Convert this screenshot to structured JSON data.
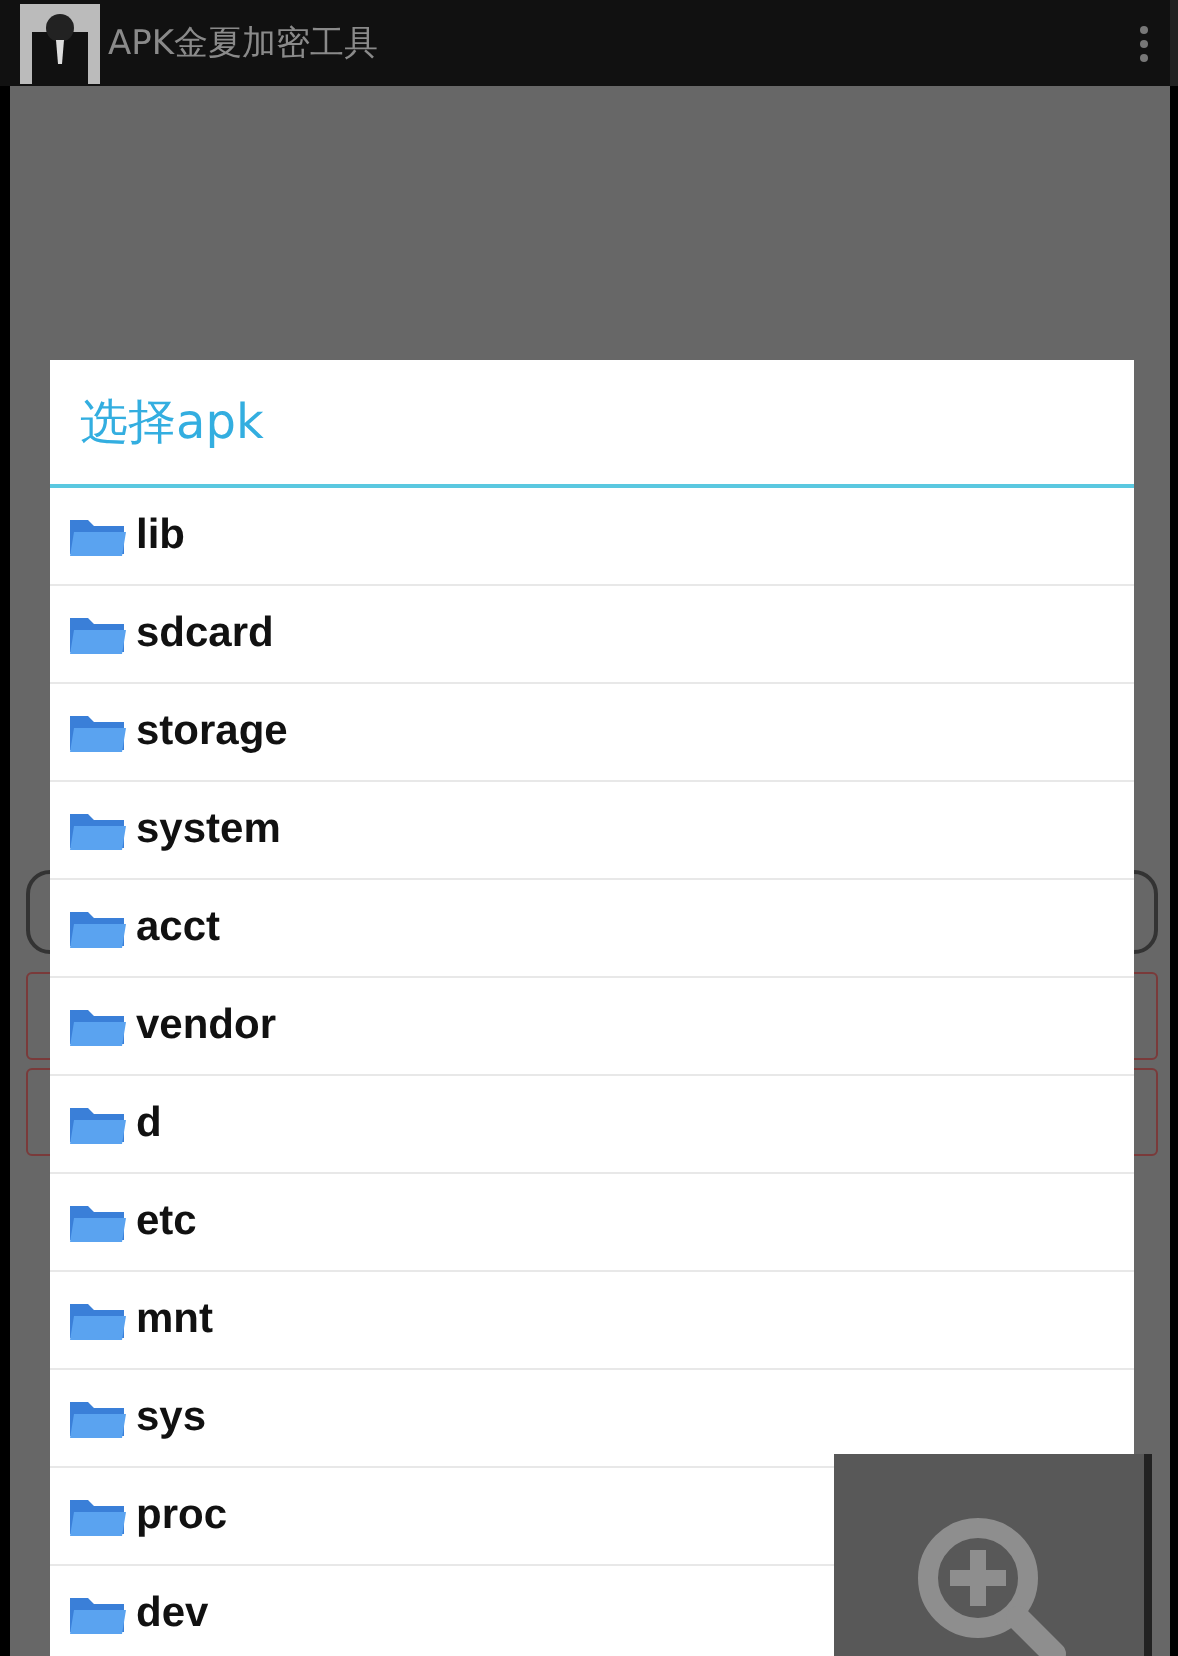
{
  "app_bar": {
    "title": "APK金夏加密工具"
  },
  "dialog": {
    "title": "选择apk",
    "items": [
      {
        "name": "lib"
      },
      {
        "name": "sdcard"
      },
      {
        "name": "storage"
      },
      {
        "name": "system"
      },
      {
        "name": "acct"
      },
      {
        "name": "vendor"
      },
      {
        "name": "d"
      },
      {
        "name": "etc"
      },
      {
        "name": "mnt"
      },
      {
        "name": "sys"
      },
      {
        "name": "proc"
      },
      {
        "name": "dev"
      }
    ]
  }
}
